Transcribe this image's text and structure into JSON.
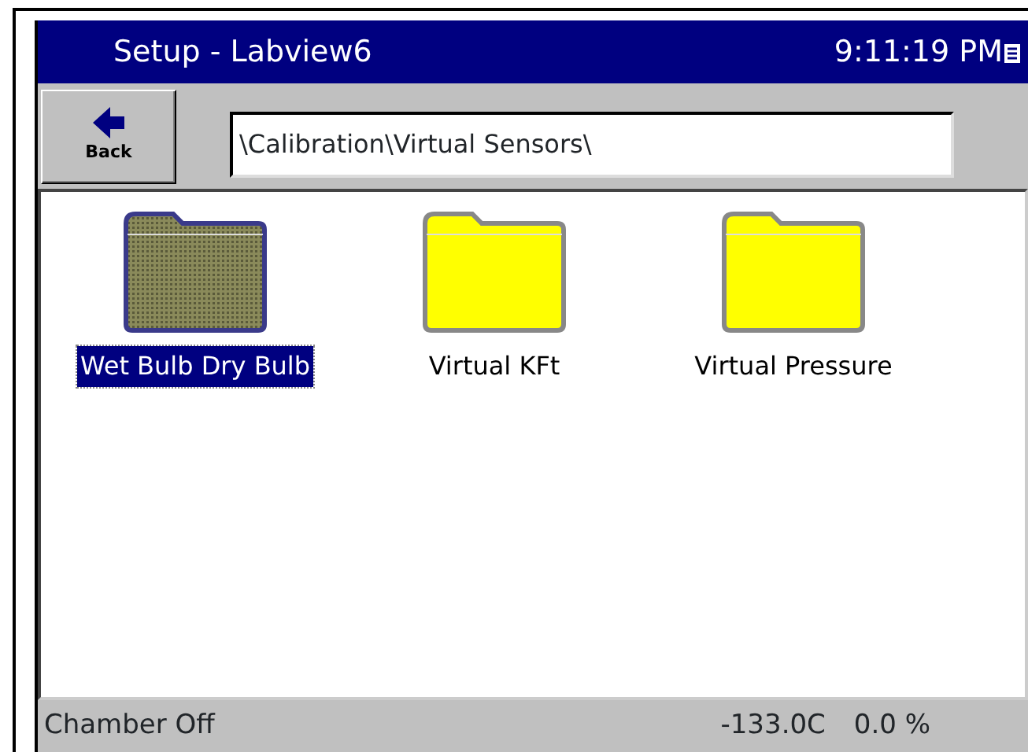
{
  "window": {
    "title": "Setup - Labview6",
    "time": "9:11:19 PM"
  },
  "toolbar": {
    "back_button": "Back",
    "path": "\\Calibration\\Virtual Sensors\\"
  },
  "folders": [
    {
      "label": "Wet Bulb Dry Bulb",
      "selected": true
    },
    {
      "label": "Virtual KFt",
      "selected": false
    },
    {
      "label": "Virtual Pressure",
      "selected": false
    }
  ],
  "status_bar": {
    "state": "Chamber Off",
    "temperature": "-133.0C",
    "humidity": "0.0 %"
  }
}
